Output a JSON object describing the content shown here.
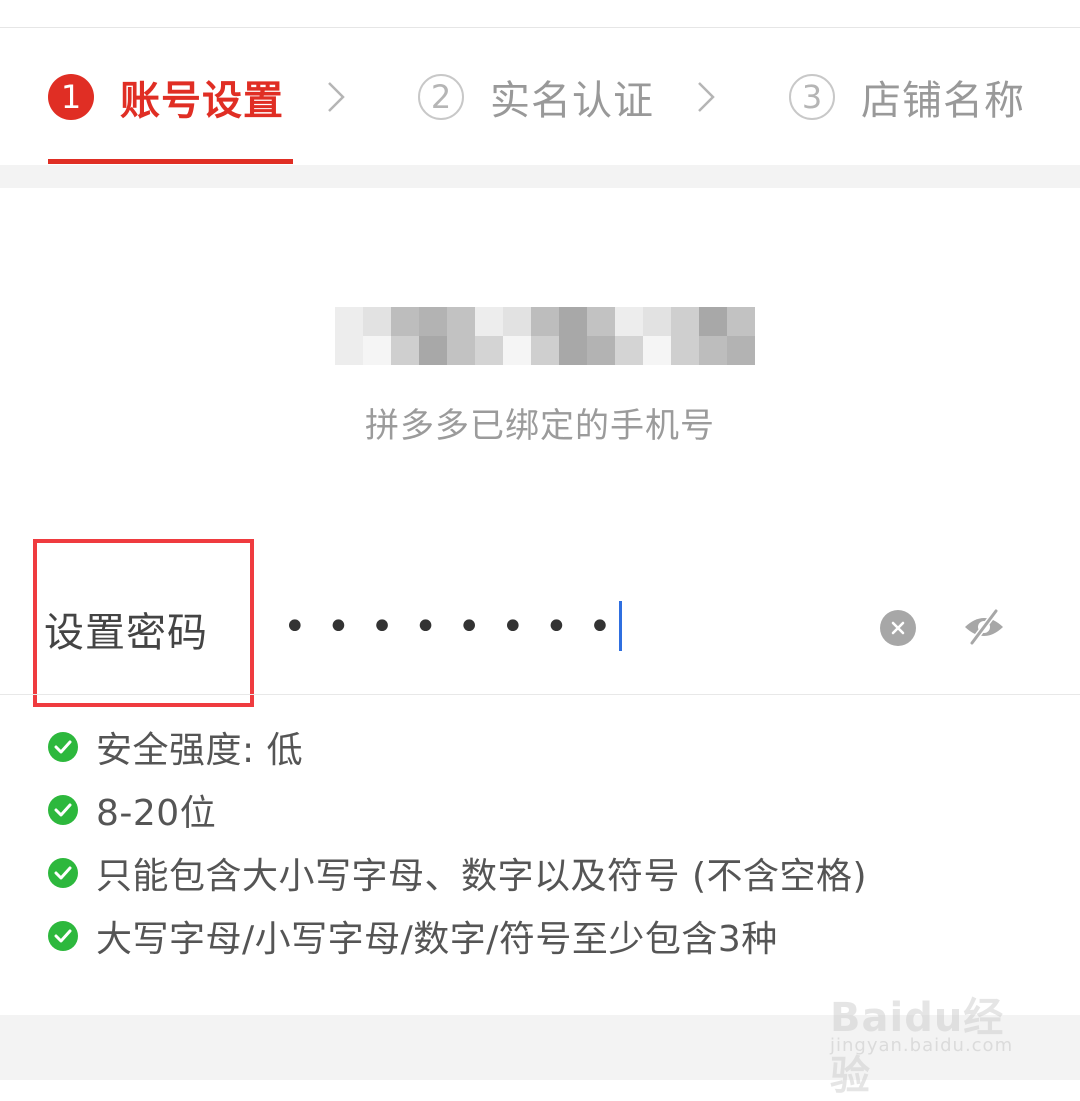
{
  "steps": [
    {
      "num": "1",
      "label": "账号设置",
      "state": "active"
    },
    {
      "num": "2",
      "label": "实名认证",
      "state": "inactive"
    },
    {
      "num": "3",
      "label": "店铺名称",
      "state": "inactive"
    }
  ],
  "icons": {
    "chevron": "chevron-right-icon",
    "clear": "clear-icon",
    "visibility": "eye-off-icon",
    "check": "check-circle-icon"
  },
  "phone": {
    "hint": "拼多多已绑定的手机号"
  },
  "password": {
    "label": "设置密码",
    "masked_value": "••••••••"
  },
  "rules": [
    "安全强度: 低",
    "8-20位",
    "只能包含大小写字母、数字以及符号 (不含空格)",
    "大写字母/小写字母/数字/符号至少包含3种"
  ],
  "watermark": {
    "logo": "Baidu经验",
    "url": "jingyan.baidu.com"
  },
  "colors": {
    "accent": "#e02e24",
    "check": "#2db83d",
    "highlight": "#ef3b3f",
    "caret": "#2f6fe0"
  }
}
